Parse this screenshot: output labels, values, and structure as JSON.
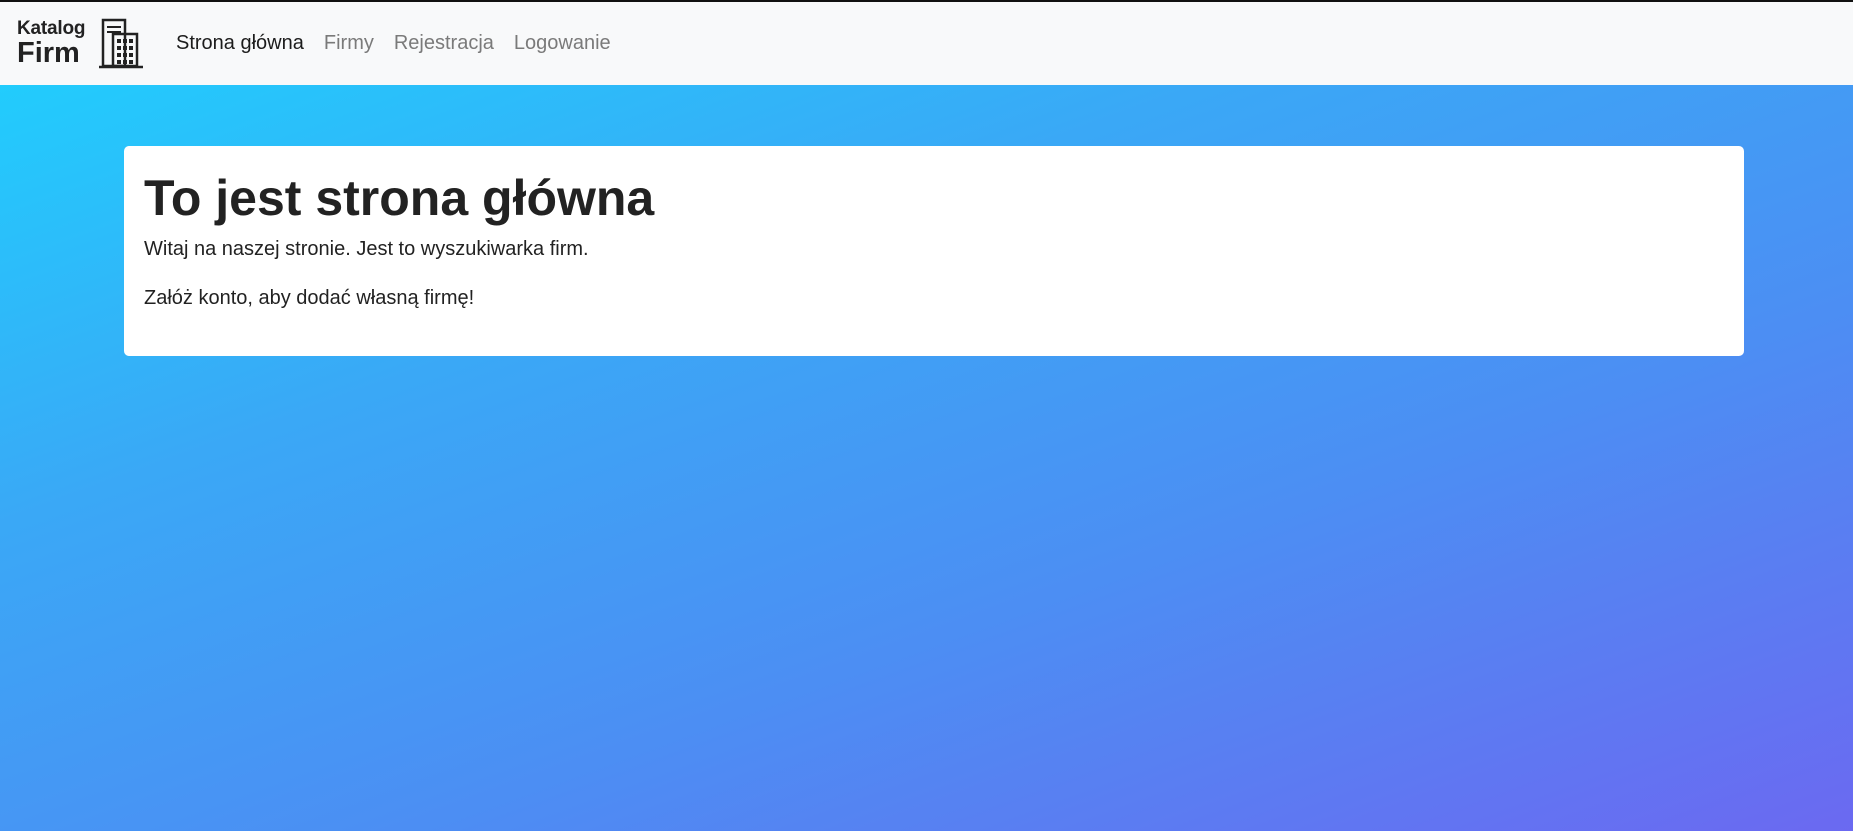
{
  "brand": {
    "line1": "Katalog",
    "line2": "Firm",
    "icon": "building-icon"
  },
  "nav": {
    "items": [
      {
        "label": "Strona główna",
        "active": true
      },
      {
        "label": "Firmy",
        "active": false
      },
      {
        "label": "Rejestracja",
        "active": false
      },
      {
        "label": "Logowanie",
        "active": false
      }
    ]
  },
  "main": {
    "title": "To jest strona główna",
    "paragraph1": "Witaj na naszej stronie. Jest to wyszukiwarka firm.",
    "paragraph2": "Załóż konto, aby dodać własną firmę!"
  },
  "colors": {
    "navbar_bg": "#f8f9fa",
    "gradient_start": "#1dd3fe",
    "gradient_end": "#6b69f1",
    "card_bg": "#ffffff",
    "text_dark": "#222222",
    "nav_muted": "#7a7a7a"
  }
}
